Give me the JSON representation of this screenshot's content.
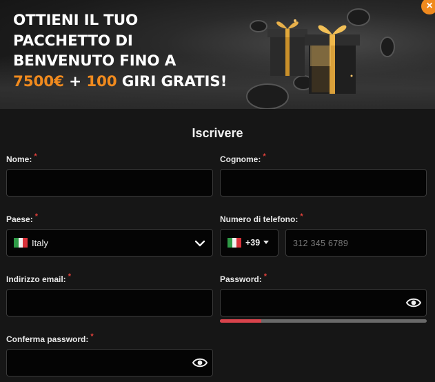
{
  "banner": {
    "line1": "OTTIENI IL TUO",
    "line2": "PACCHETTO DI",
    "line3": "BENVENUTO FINO A",
    "amount": "7500€",
    "plus": " + ",
    "spins": "100",
    "spins_suffix": " GIRI GRATIS!"
  },
  "close_label": "×",
  "form": {
    "title": "Iscrivere",
    "required_mark": "*",
    "first_name": {
      "label": "Nome:",
      "value": ""
    },
    "last_name": {
      "label": "Cognome:",
      "value": ""
    },
    "country": {
      "label": "Paese:",
      "value": "Italy"
    },
    "phone": {
      "label": "Numero di telefono:",
      "prefix": "+39",
      "placeholder": "312 345 6789",
      "value": ""
    },
    "email": {
      "label": "Indirizzo email:",
      "value": ""
    },
    "password": {
      "label": "Password:",
      "value": "",
      "strength": 0.2
    },
    "confirm_password": {
      "label": "Conferma password:",
      "value": ""
    }
  },
  "colors": {
    "accent": "#f08a1e",
    "required": "#e0403a",
    "strength_weak": "#d9434c"
  }
}
